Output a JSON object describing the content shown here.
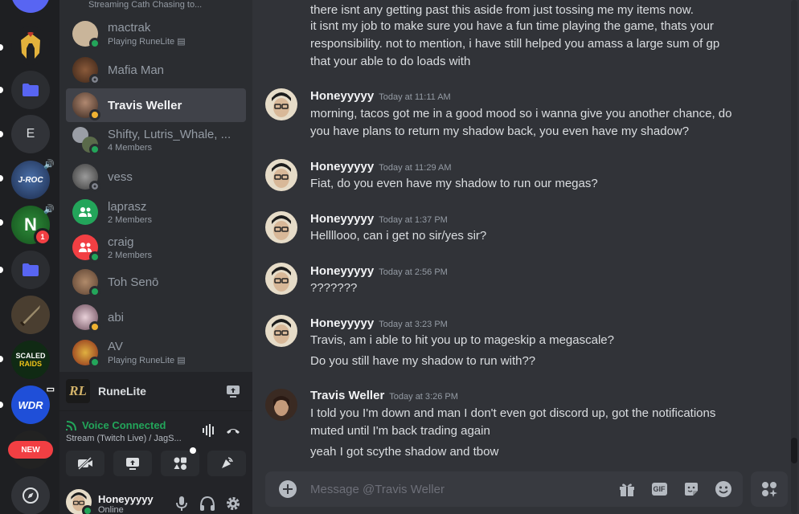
{
  "rail": {
    "top_item_label": "Streaming Cath Chasing to...",
    "letter_server": "E",
    "jroc_label": "J-ROC",
    "n_server_letter": "N",
    "n_server_badge": "1",
    "scaled_raids_line1": "SCALED",
    "scaled_raids_line2": "RAIDS",
    "wdr_label": "WDR",
    "new_label": "NEW"
  },
  "dms": [
    {
      "name": "mactrak",
      "sub": "Playing RuneLite",
      "status": "on"
    },
    {
      "name": "Mafia Man",
      "sub": "",
      "status": "off"
    },
    {
      "name": "Travis Weller",
      "sub": "",
      "status": "idle",
      "active": true
    },
    {
      "name": "Shifty, Lutris_Whale, ...",
      "sub": "4 Members",
      "status": "on"
    },
    {
      "name": "vess",
      "sub": "",
      "status": "off"
    },
    {
      "name": "laprasz",
      "sub": "2 Members",
      "status": ""
    },
    {
      "name": "craig",
      "sub": "2 Members",
      "status": "on"
    },
    {
      "name": "Toh Senō",
      "sub": "",
      "status": "on"
    },
    {
      "name": "abi",
      "sub": "",
      "status": "idle"
    },
    {
      "name": "AV",
      "sub": "Playing RuneLite",
      "status": "on"
    }
  ],
  "stream_panel": {
    "title": "RuneLite",
    "logo": "RL"
  },
  "voice": {
    "status": "Voice Connected",
    "detail": "Stream (Twitch Live) / JagS..."
  },
  "user": {
    "name": "Honeyyyyy",
    "status": "Online"
  },
  "messages": {
    "prev_lines": [
      "there isnt any getting past this aside from just tossing me my items now.",
      "it isnt my job to make sure you have a fun time playing the game, thats your",
      "responsibility. not to mention, i have still helped you amass a large sum of gp",
      "that your able to do loads with"
    ],
    "groups": [
      {
        "author": "Honeyyyyy",
        "time": "Today at 11:11 AM",
        "lines": [
          "morning, tacos got me in a good mood so i wanna give you another chance, do",
          "you have plans to return my shadow back, you even have my shadow?"
        ]
      },
      {
        "author": "Honeyyyyy",
        "time": "Today at 11:29 AM",
        "lines": [
          "Fiat, do you even have my shadow to run our megas?"
        ]
      },
      {
        "author": "Honeyyyyy",
        "time": "Today at 1:37 PM",
        "lines": [
          "Hellllooo, can i get no sir/yes sir?"
        ]
      },
      {
        "author": "Honeyyyyy",
        "time": "Today at 2:56 PM",
        "lines": [
          "???????"
        ]
      },
      {
        "author": "Honeyyyyy",
        "time": "Today at 3:23 PM",
        "lines": [
          "Travis, am i able to hit you up to mageskip a megascale?"
        ],
        "followup": "Do you still have my shadow to run with??"
      },
      {
        "author": "Travis Weller",
        "time": "Today at 3:26 PM",
        "lines": [
          "I told you I'm down and man I don't even got discord up, got the notifications",
          "muted until I'm back trading again"
        ],
        "followup": "yeah I got scythe shadow and tbow"
      }
    ]
  },
  "composer": {
    "placeholder": "Message @Travis Weller",
    "gif_label": "GIF"
  },
  "colors": {
    "accent": "#5865f2",
    "online": "#23a55a",
    "idle": "#f0b232",
    "danger": "#f23f43"
  }
}
